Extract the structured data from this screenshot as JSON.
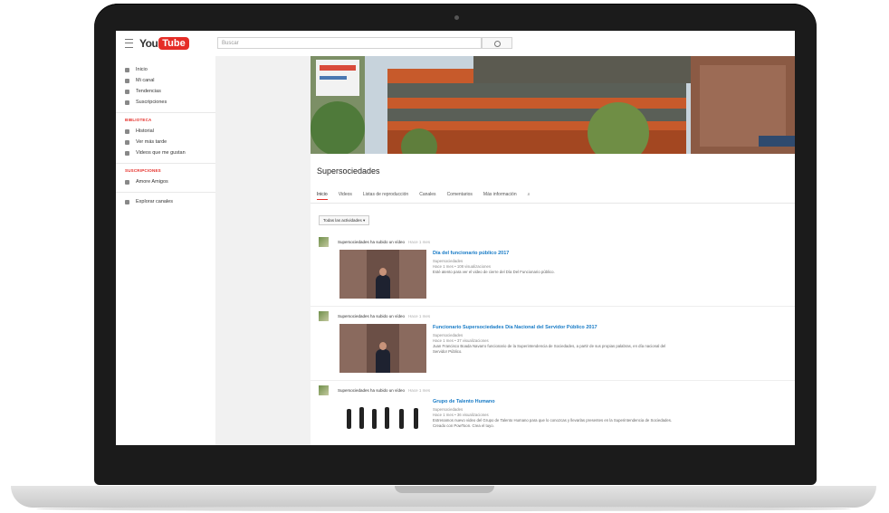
{
  "app": {
    "logo_you": "You",
    "logo_tube": "Tube",
    "search_placeholder": "Buscar"
  },
  "sidebar": {
    "items_top": [
      {
        "label": "Inicio"
      },
      {
        "label": "Mi canal"
      },
      {
        "label": "Tendencias"
      },
      {
        "label": "Suscripciones"
      }
    ],
    "library_header": "BIBLIOTECA",
    "library_items": [
      {
        "label": "Historial"
      },
      {
        "label": "Ver más tarde"
      },
      {
        "label": "Videos que me gustan"
      }
    ],
    "subs_header": "SUSCRIPCIONES",
    "subs_items": [
      {
        "label": "Amore Amigos"
      }
    ],
    "manage_label": "Explorar canales"
  },
  "channel": {
    "title": "Supersociedades",
    "tabs": [
      "Inicio",
      "Videos",
      "Listas de reproducción",
      "Canales",
      "Comentarios",
      "Más información"
    ],
    "filter_label": "Todas las actividades ▾"
  },
  "feed": [
    {
      "header": "Supersociedades ha subido un vídeo",
      "time": "Hace 1 mes",
      "title": "Día del funcionario público 2017",
      "channel": "Supersociedades",
      "meta": "Hace 1 mes • 108 visualizaciones",
      "desc": "Esté atento para ver el video de cierre del Día Del Funcionario público."
    },
    {
      "header": "Supersociedades ha subido un vídeo",
      "time": "Hace 1 mes",
      "title": "Funcionario Supersociedades Día Nacional del Servidor Público 2017",
      "channel": "Supersociedades",
      "meta": "Hace 1 mes • 37 visualizaciones",
      "desc": "Juan Francisco Boada Navarro funcionario de la Superintendencia de Sociedades, a partir de sus propias palabras, en día nacional del Servidor Público."
    },
    {
      "header": "Supersociedades ha subido un vídeo",
      "time": "Hace 1 mes",
      "title": "Grupo de Talento Humano",
      "channel": "Supersociedades",
      "meta": "Hace 1 mes • 36 visualizaciones",
      "desc": "Estrenamos nuevo video del Grupo de Talento Humano para que lo conozcas y llevarlas presentes en la Superintendencia de Sociedades. Creado con PowToon. Crea el tuyo."
    }
  ],
  "colors": {
    "accent_red": "#e52d27",
    "link_blue": "#167ac6"
  }
}
